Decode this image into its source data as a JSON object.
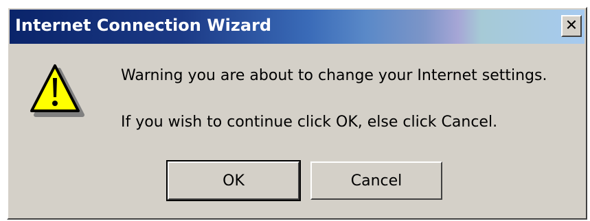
{
  "window": {
    "title": "Internet Connection Wizard",
    "close_label": "✕"
  },
  "dialog": {
    "icon": "warning-icon",
    "message_line1": "Warning you are about to change your Internet settings.",
    "message_line2": "If you wish to continue click OK, else click Cancel.",
    "ok_label": "OK",
    "cancel_label": "Cancel"
  },
  "colors": {
    "face": "#d4d0c8",
    "titlebar_start": "#0a246a",
    "titlebar_end": "#a6caf0",
    "warning_yellow": "#ffff00"
  }
}
